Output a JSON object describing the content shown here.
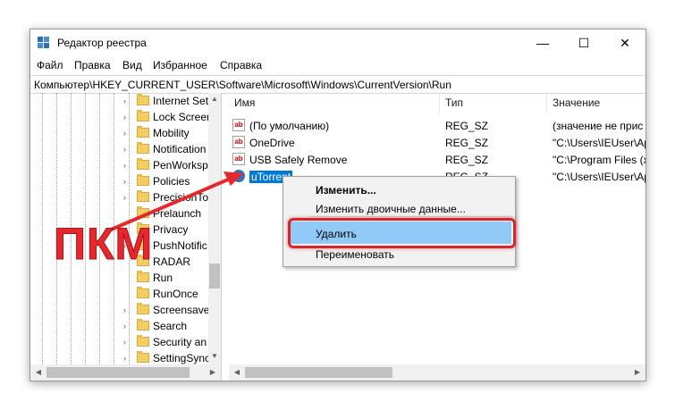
{
  "window": {
    "title": "Редактор реестра",
    "controls": {
      "minimize": "—",
      "maximize": "☐",
      "close": "✕"
    }
  },
  "menu": [
    "Файл",
    "Правка",
    "Вид",
    "Избранное",
    "Справка"
  ],
  "address": "Компьютер\\HKEY_CURRENT_USER\\Software\\Microsoft\\Windows\\CurrentVersion\\Run",
  "tree": {
    "items": [
      "Internet Set",
      "Lock Screen",
      "Mobility",
      "Notification",
      "PenWorksp",
      "Policies",
      "PrecisionTo",
      "Prelaunch",
      "Privacy",
      "PushNotific",
      "RADAR",
      "Run",
      "RunOnce",
      "Screensave",
      "Search",
      "Security an",
      "SettingSync"
    ],
    "selected_index": 11
  },
  "list": {
    "columns": {
      "name": "Имя",
      "type": "Тип",
      "value": "Значение"
    },
    "rows": [
      {
        "name": "(По умолчанию)",
        "type": "REG_SZ",
        "value": "(значение не прис",
        "icon": "ab-string-icon"
      },
      {
        "name": "OneDrive",
        "type": "REG_SZ",
        "value": "\"C:\\Users\\IEUser\\Ap",
        "icon": "ab-string-icon"
      },
      {
        "name": "USB Safely Remove",
        "type": "REG_SZ",
        "value": "\"C:\\Program Files (x",
        "icon": "ab-string-icon"
      },
      {
        "name": "uTorrent",
        "type": "REG_SZ",
        "value": "\"C:\\Users\\IEUser\\Ap",
        "icon": "binary-icon"
      }
    ],
    "selected_index": 3
  },
  "context_menu": {
    "items": [
      "Изменить...",
      "Изменить двоичные данные...",
      "Удалить",
      "Переименовать"
    ],
    "highlighted_index": 2
  },
  "annotation": {
    "label": "ПКМ",
    "color": "#e6272b"
  }
}
